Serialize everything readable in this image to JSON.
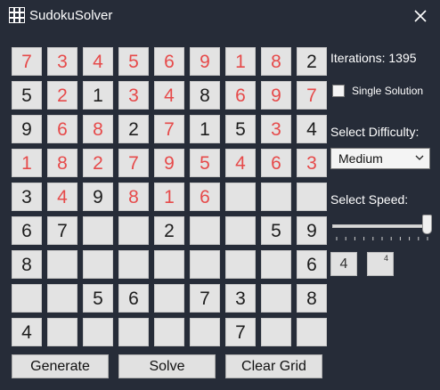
{
  "window": {
    "title": "SudokuSolver",
    "app_icon": "grid-icon",
    "close_icon": "close-icon"
  },
  "grid": {
    "values": [
      [
        "7",
        "3",
        "4",
        "5",
        "6",
        "9",
        "1",
        "8",
        "2"
      ],
      [
        "5",
        "2",
        "1",
        "3",
        "4",
        "8",
        "6",
        "9",
        "7"
      ],
      [
        "9",
        "6",
        "8",
        "2",
        "7",
        "1",
        "5",
        "3",
        "4"
      ],
      [
        "1",
        "8",
        "2",
        "7",
        "9",
        "5",
        "4",
        "6",
        "3"
      ],
      [
        "3",
        "4",
        "9",
        "8",
        "1",
        "6",
        "",
        "",
        ""
      ],
      [
        "6",
        "7",
        "",
        "",
        "2",
        "",
        "",
        "5",
        "9"
      ],
      [
        "8",
        "",
        "",
        "",
        "",
        "",
        "",
        "",
        "6"
      ],
      [
        "",
        "",
        "5",
        "6",
        "",
        "7",
        "3",
        "",
        "8"
      ],
      [
        "4",
        "",
        "",
        "",
        "",
        "",
        "7",
        "",
        ""
      ]
    ],
    "solved_mask": [
      [
        1,
        1,
        1,
        1,
        1,
        1,
        1,
        1,
        0
      ],
      [
        0,
        1,
        0,
        1,
        1,
        0,
        1,
        1,
        1
      ],
      [
        0,
        1,
        1,
        0,
        1,
        0,
        0,
        1,
        0
      ],
      [
        1,
        1,
        1,
        1,
        1,
        1,
        1,
        1,
        1
      ],
      [
        0,
        1,
        0,
        1,
        1,
        1,
        0,
        0,
        0
      ],
      [
        0,
        0,
        0,
        0,
        0,
        0,
        0,
        0,
        0
      ],
      [
        0,
        0,
        0,
        0,
        0,
        0,
        0,
        0,
        0
      ],
      [
        0,
        0,
        0,
        0,
        0,
        0,
        0,
        0,
        0
      ],
      [
        0,
        0,
        0,
        0,
        0,
        0,
        0,
        0,
        0
      ]
    ],
    "given_color": "#1d1d1d",
    "solved_color": "#e64a4a"
  },
  "buttons": {
    "generate": "Generate",
    "solve": "Solve",
    "clear": "Clear Grid"
  },
  "panel": {
    "iterations_text": "Iterations: 1395",
    "single_solution_label": "Single Solution",
    "single_solution_checked": false,
    "difficulty_label": "Select Difficulty:",
    "difficulty_value": "Medium",
    "speed_label": "Select Speed:",
    "speed_slider_value": 10,
    "speed_slider_max": 10,
    "speed_value": "4",
    "speed_small_value": "4"
  },
  "colors": {
    "background": "#262c38",
    "cell": "#e3e3e3"
  }
}
